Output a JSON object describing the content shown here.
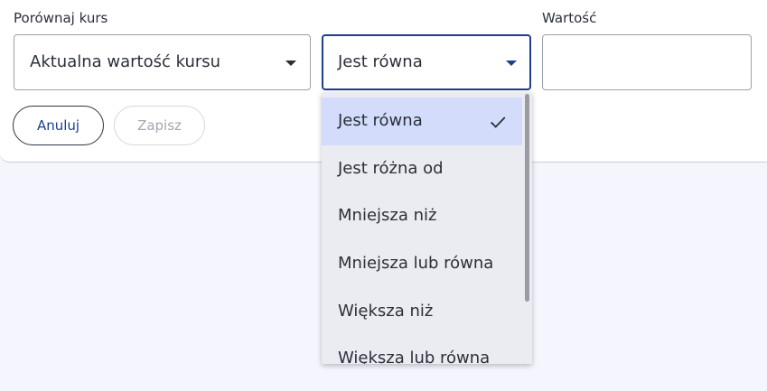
{
  "form": {
    "compare_label": "Porównaj kurs",
    "compare_value": "Aktualna wartość kursu",
    "operator_value": "Jest równa",
    "value_label": "Wartość",
    "value_input": ""
  },
  "buttons": {
    "cancel_label": "Anuluj",
    "save_label": "Zapisz"
  },
  "operator_options": [
    {
      "label": "Jest równa",
      "selected": true
    },
    {
      "label": "Jest różna od",
      "selected": false
    },
    {
      "label": "Mniejsza niż",
      "selected": false
    },
    {
      "label": "Mniejsza lub równa",
      "selected": false
    },
    {
      "label": "Większa niż",
      "selected": false
    },
    {
      "label": "Większa lub równa",
      "selected": false
    }
  ],
  "colors": {
    "accent": "#1f3f8f",
    "selected_option_bg": "#d3dcfb",
    "page_bg": "#f5f6fd"
  },
  "icons": {
    "dropdown_caret": "chevron-down-icon",
    "selected_check": "check-icon"
  }
}
